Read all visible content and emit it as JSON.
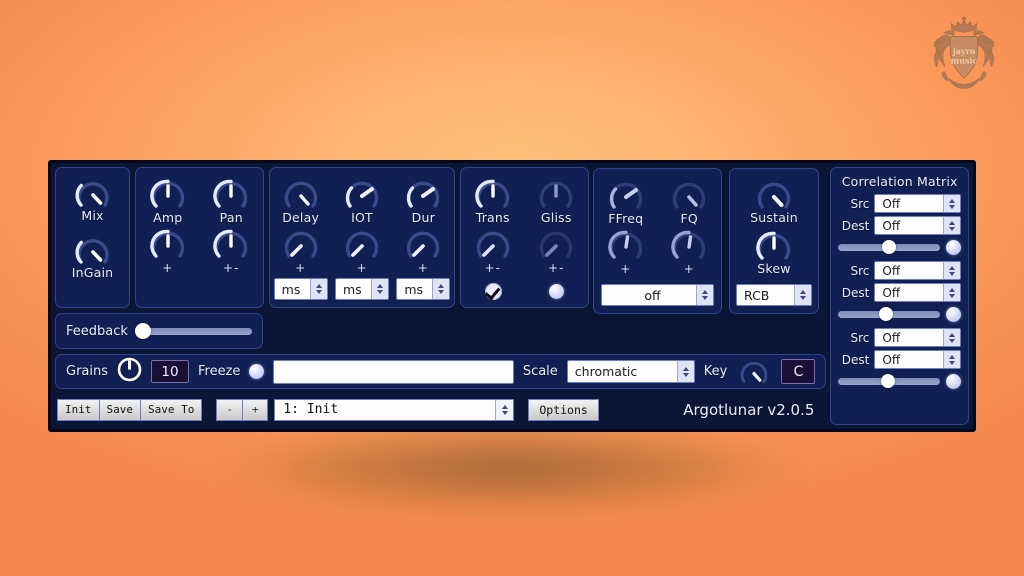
{
  "branding": {
    "logo_alt": "jayro music crest logo",
    "logo_line1": "jayro",
    "logo_line2": "music"
  },
  "plugin": {
    "version_text": "Argotlunar v2.0.5",
    "mix_panel": {
      "knobs": [
        {
          "label": "Mix",
          "angle": 135
        },
        {
          "label": "InGain",
          "angle": 135
        }
      ]
    },
    "amp_panel": {
      "columns": [
        {
          "label": "Amp",
          "top_angle": 0,
          "bottom_angle": 0,
          "mod": "+"
        },
        {
          "label": "Pan",
          "top_angle": 0,
          "bottom_angle": 0,
          "mod": "+-"
        }
      ]
    },
    "delay_panel": {
      "columns": [
        {
          "label": "Delay",
          "top_angle": 118,
          "bottom_angle": 126,
          "mod": "+",
          "unit": "ms"
        },
        {
          "label": "IOT",
          "top_angle": -60,
          "bottom_angle": 126,
          "mod": "+",
          "unit": "ms"
        },
        {
          "label": "Dur",
          "top_angle": -60,
          "bottom_angle": 126,
          "mod": "+",
          "unit": "ms"
        }
      ]
    },
    "trans_panel": {
      "columns": [
        {
          "label": "Trans",
          "top_angle": 0,
          "bottom_angle": 126,
          "mod": "+-",
          "toggle": "checkbox",
          "checked": true
        },
        {
          "label": "Gliss",
          "top_angle": 0,
          "bottom_angle": 126,
          "mod": "+-",
          "toggle": "dot",
          "checked": false
        }
      ]
    },
    "filter_panel": {
      "columns": [
        {
          "label": "FFreq",
          "top_angle": -50,
          "bottom_angle": -8,
          "mod": "+"
        },
        {
          "label": "FQ",
          "top_angle": 128,
          "bottom_angle": -8,
          "mod": "+"
        }
      ],
      "select_value": "off"
    },
    "sustain_panel": {
      "knobs": [
        {
          "label": "Sustain",
          "angle": 135
        },
        {
          "label": "Skew",
          "angle": 0
        }
      ],
      "select_value": "RCB"
    },
    "feedback": {
      "label": "Feedback",
      "value_pct": 4
    },
    "grains": {
      "label": "Grains",
      "knob_angle": 0,
      "count_value": "10",
      "freeze_label": "Freeze",
      "freeze_on": false,
      "text_field_value": ""
    },
    "scale": {
      "label": "Scale",
      "value": "chromatic"
    },
    "key": {
      "label": "Key",
      "knob_angle": 135,
      "value": "C"
    },
    "transport": {
      "init_label": "Init",
      "save_label": "Save",
      "save_to_label": "Save To",
      "minus_label": "-",
      "plus_label": "+",
      "preset_value": "1: Init",
      "options_label": "Options"
    },
    "correlation_matrix": {
      "title": "Correlation Matrix",
      "src_label": "Src",
      "dest_label": "Dest",
      "groups": [
        {
          "src": "Off",
          "dest": "Off",
          "amount_pct": 50
        },
        {
          "src": "Off",
          "dest": "Off",
          "amount_pct": 47
        },
        {
          "src": "Off",
          "dest": "Off",
          "amount_pct": 49
        }
      ]
    }
  },
  "colors": {
    "background_light": "#ffc07c",
    "background_dark": "#f5884c",
    "panel_fill": "#111f52",
    "panel_border": "#31458c",
    "window_bg": "#0b1536",
    "window_border": "#05091c",
    "text_light": "#e9ecff",
    "knob_bright": "#e7ebff",
    "knob_dim": "#5d6ba6",
    "display_bg": "#1a0f35",
    "display_border": "#7a6fae"
  }
}
